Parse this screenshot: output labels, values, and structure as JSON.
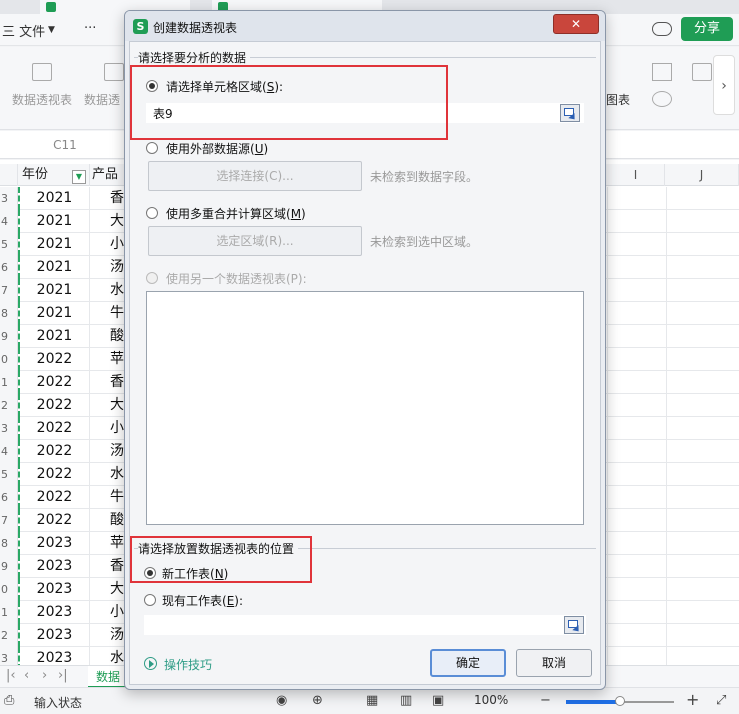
{
  "app": {
    "menu": {
      "file": "三 文件",
      "more": "···",
      "share": "分享"
    },
    "ribbon": {
      "pivot_table": "数据透视表",
      "pivot_chart_trunc": "数据透",
      "chart_right": "图表",
      "next_arrow": "›"
    },
    "namebox": "C11",
    "columns": {
      "year": "年份",
      "product": "产品",
      "col_i": "I",
      "col_j": "J"
    },
    "rows": [
      {
        "num": "3",
        "year": "2021",
        "prod": "香"
      },
      {
        "num": "4",
        "year": "2021",
        "prod": "大"
      },
      {
        "num": "5",
        "year": "2021",
        "prod": "小"
      },
      {
        "num": "6",
        "year": "2021",
        "prod": "汤"
      },
      {
        "num": "7",
        "year": "2021",
        "prod": "水"
      },
      {
        "num": "8",
        "year": "2021",
        "prod": "牛"
      },
      {
        "num": "9",
        "year": "2021",
        "prod": "酸"
      },
      {
        "num": "0",
        "year": "2022",
        "prod": "苹"
      },
      {
        "num": "1",
        "year": "2022",
        "prod": "香"
      },
      {
        "num": "2",
        "year": "2022",
        "prod": "大"
      },
      {
        "num": "3",
        "year": "2022",
        "prod": "小"
      },
      {
        "num": "4",
        "year": "2022",
        "prod": "汤"
      },
      {
        "num": "5",
        "year": "2022",
        "prod": "水"
      },
      {
        "num": "6",
        "year": "2022",
        "prod": "牛"
      },
      {
        "num": "7",
        "year": "2022",
        "prod": "酸"
      },
      {
        "num": "8",
        "year": "2023",
        "prod": "苹"
      },
      {
        "num": "9",
        "year": "2023",
        "prod": "香"
      },
      {
        "num": "0",
        "year": "2023",
        "prod": "大"
      },
      {
        "num": "1",
        "year": "2023",
        "prod": "小"
      },
      {
        "num": "2",
        "year": "2023",
        "prod": "汤"
      },
      {
        "num": "3",
        "year": "2023",
        "prod": "水"
      }
    ],
    "sheet_tab": "数据",
    "status": "输入状态",
    "zoom": "100%",
    "zoom_value": 0.5
  },
  "dialog": {
    "title": "创建数据透视表",
    "close": "✕",
    "section_source": "请选择要分析的数据",
    "opt_range_pre": "请选择单元格区域(",
    "opt_range_key": "S",
    "opt_range_post": "):",
    "range_value": "表9",
    "opt_external_pre": "使用外部数据源(",
    "opt_external_key": "U",
    "opt_external_post": ")",
    "btn_select_conn": "选择连接(C)...",
    "hint_no_fields": "未检索到数据字段。",
    "opt_multi_pre": "使用多重合并计算区域(",
    "opt_multi_key": "M",
    "opt_multi_post": ")",
    "btn_select_area": "选定区域(R)...",
    "hint_no_area": "未检索到选中区域。",
    "opt_other_pivot": "使用另一个数据透视表(P):",
    "section_place": "请选择放置数据透视表的位置",
    "opt_new_pre": "新工作表(",
    "opt_new_key": "N",
    "opt_new_post": ")",
    "opt_existing_pre": "现有工作表(",
    "opt_existing_key": "E",
    "opt_existing_post": "):",
    "existing_value": "",
    "tips": "操作技巧",
    "ok": "确定",
    "cancel": "取消"
  },
  "colors": {
    "accent_green": "#1f9d55",
    "highlight_red": "#e0343a",
    "link_teal": "#2e9c86"
  }
}
